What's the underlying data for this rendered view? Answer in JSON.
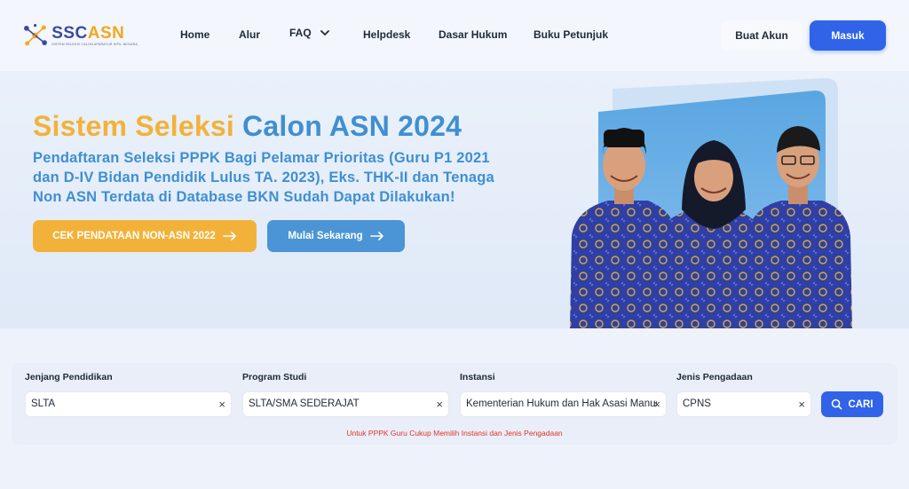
{
  "brand": {
    "name_part1": "SSC",
    "name_part2": "ASN",
    "tagline": "SISTEM SELEKSI CALON APARATUR SIPIL NEGARA"
  },
  "nav": {
    "home": "Home",
    "alur": "Alur",
    "faq": "FAQ",
    "helpdesk": "Helpdesk",
    "dasar_hukum": "Dasar Hukum",
    "buku_petunjuk": "Buku Petunjuk",
    "buat_akun": "Buat Akun",
    "masuk": "Masuk"
  },
  "hero": {
    "title_part1": "Sistem Seleksi",
    "title_part2": "Calon ASN 2024",
    "subtitle": "Pendaftaran Seleksi PPPK Bagi Pelamar Prioritas (Guru P1 2021 dan D-IV Bidan Pendidik Lulus TA. 2023), Eks. THK-II dan Tenaga Non ASN Terdata di Database BKN Sudah Dapat Dilakukan!",
    "btn_cek": "CEK PENDATAAN NON-ASN 2022",
    "btn_mulai": "Mulai Sekarang"
  },
  "search": {
    "jenjang": {
      "label": "Jenjang Pendidikan",
      "value": "SLTA"
    },
    "prodi": {
      "label": "Program Studi",
      "value": "SLTA/SMA SEDERAJAT"
    },
    "instansi": {
      "label": "Instansi",
      "value": "Kementerian Hukum dan Hak Asasi Manus"
    },
    "pengadaan": {
      "label": "Jenis Pengadaan",
      "value": "CPNS"
    },
    "clear_glyph": "×",
    "cari": "CARI",
    "note": "Untuk PPPK Guru Cukup Memilih Instansi dan Jenis Pengadaan"
  },
  "colors": {
    "primary": "#3163e8",
    "accent_yellow": "#f2b23a",
    "accent_blue": "#3f8fd2",
    "note_red": "#e0342b"
  }
}
